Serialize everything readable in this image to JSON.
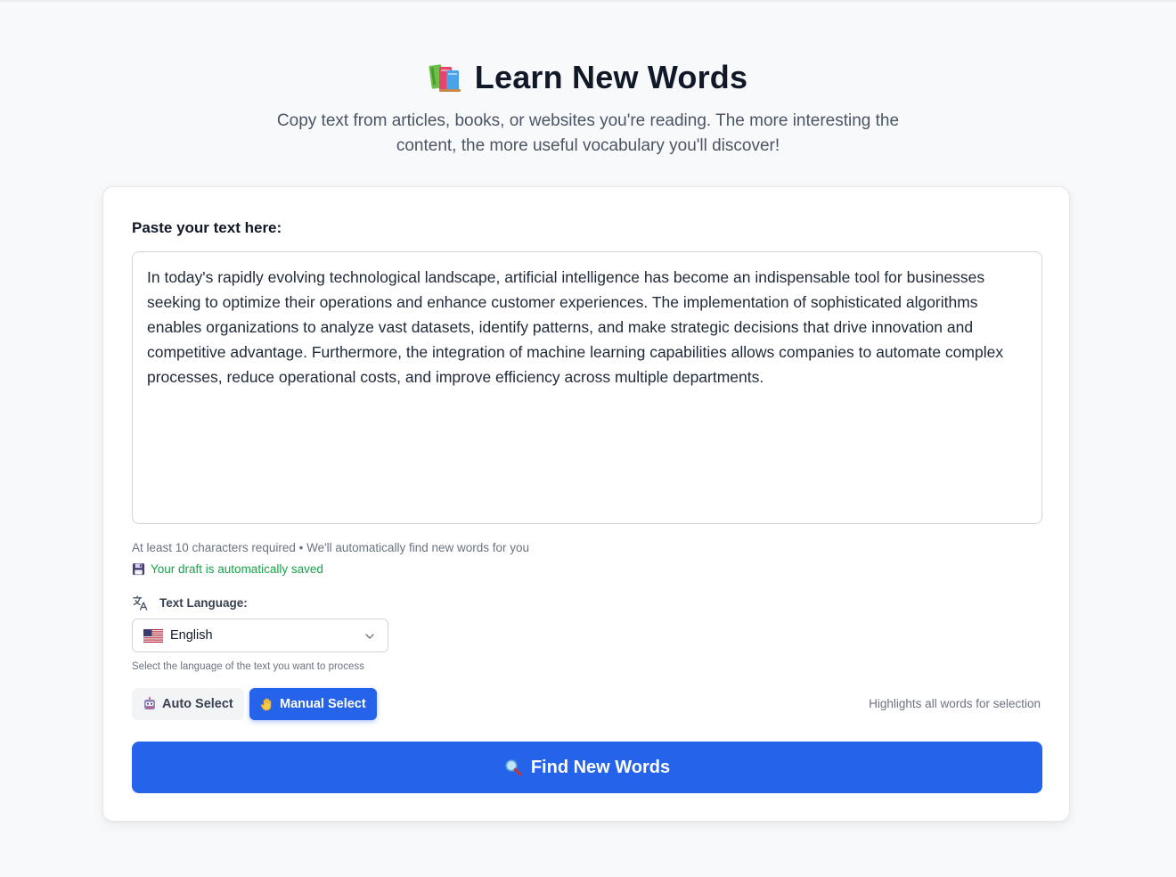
{
  "header": {
    "icon": "books-icon",
    "title": "Learn New Words",
    "subtitle": "Copy text from articles, books, or websites you're reading. The more interesting the content, the more useful vocabulary you'll discover!"
  },
  "form": {
    "paste_label": "Paste your text here:",
    "text_value": "In today's rapidly evolving technological landscape, artificial intelligence has become an indispensable tool for businesses seeking to optimize their operations and enhance customer experiences. The implementation of sophisticated algorithms enables organizations to analyze vast datasets, identify patterns, and make strategic decisions that drive innovation and competitive advantage. Furthermore, the integration of machine learning capabilities allows companies to automate complex processes, reduce operational costs, and improve efficiency across multiple departments.",
    "helper_text": "At least 10 characters required • We'll automatically find new words for you",
    "draft_icon": "floppy-disk-icon",
    "draft_text": "Your draft is automatically saved"
  },
  "language": {
    "label_icon": "translate-icon",
    "label": "Text Language:",
    "selected": "English",
    "selected_flag": "us-flag-icon",
    "hint": "Select the language of the text you want to process"
  },
  "mode": {
    "auto_label": "Auto Select",
    "auto_icon": "robot-icon",
    "manual_label": "Manual Select",
    "manual_icon": "hand-icon",
    "active": "Manual Select",
    "hint": "Highlights all words for selection"
  },
  "actions": {
    "find_label": "Find New Words",
    "find_icon": "magnifier-icon"
  },
  "colors": {
    "primary": "#2563eb",
    "success": "#16a34a",
    "background": "#f8f9fb"
  }
}
